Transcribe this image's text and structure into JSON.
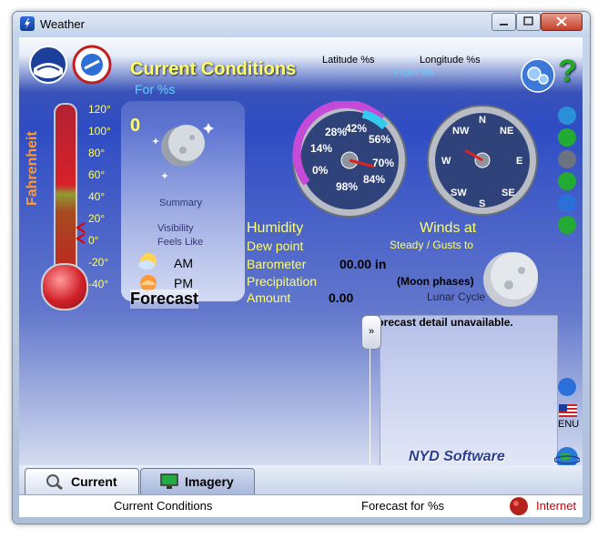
{
  "window": {
    "title": "Weather"
  },
  "header": {
    "title": "Current Conditions",
    "subtitle": "For %s",
    "latitude": "Latitude %s",
    "longitude": "Longitude %s",
    "from": "From %s",
    "help": "?"
  },
  "thermometer": {
    "unit_label": "Fahrenheit",
    "ticks": [
      "120°",
      "100°",
      "80°",
      "60°",
      "40°",
      "20°",
      "0°",
      "-20°",
      "-40°"
    ]
  },
  "conditions": {
    "temperature": "0",
    "summary": "Summary",
    "visibility": "Visibility",
    "feels_like": "Feels Like",
    "am": "AM",
    "pm": "PM",
    "forecast": "Forecast"
  },
  "humidity_gauge": {
    "labels": [
      "28%",
      "42%",
      "56%",
      "14%",
      "70%",
      "0%",
      "84%",
      "98%"
    ]
  },
  "wind_compass": {
    "labels": [
      "N",
      "NW",
      "NE",
      "W",
      "E",
      "SW",
      "SE",
      "S"
    ]
  },
  "details": {
    "humidity": "Humidity",
    "dew_point": "Dew point",
    "barometer": "Barometer",
    "barometer_value": "00.00 in",
    "precipitation": "Precipitation",
    "amount": "Amount",
    "amount_value": "0.00",
    "winds_at": "Winds at",
    "steady_gusts": "Steady / Gusts to",
    "moon_phases": "(Moon phases)",
    "lunar_cycle": "Lunar Cycle",
    "forecast_detail": "Forecast detail unavailable.",
    "scroll_glyph": "»"
  },
  "side": {
    "enu": "ENU"
  },
  "logo": "NYD Software",
  "tabs": {
    "current": "Current",
    "imagery": "Imagery"
  },
  "status": {
    "current_conditions": "Current Conditions",
    "forecast_for": "Forecast for %s",
    "internet": "Internet"
  },
  "colors": {
    "accent_yellow": "#ffff66",
    "accent_cyan": "#66ccff",
    "internet_red": "#cc0000"
  }
}
